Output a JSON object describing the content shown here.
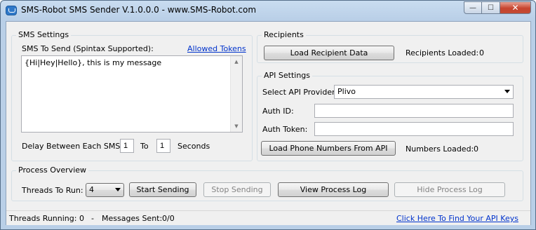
{
  "window": {
    "title": "SMS-Robot SMS Sender V.1.0.0.0 - www.SMS-Robot.com",
    "close_glyph": "✕",
    "min_glyph": "—",
    "max_glyph": "☐"
  },
  "sms_settings": {
    "group_label": "SMS Settings",
    "message_label": "SMS To Send (Spintax Supported):",
    "allowed_tokens_link": "Allowed Tokens",
    "message_text": "{Hi|Hey|Hello}, this is my message",
    "delay_label": "Delay Between Each SMS:",
    "delay_from": "1",
    "to_label": "To",
    "delay_to": "1",
    "seconds_label": "Seconds"
  },
  "recipients": {
    "group_label": "Recipients",
    "load_button": "Load Recipient Data",
    "loaded_label": "Recipients Loaded:",
    "loaded_count": "0"
  },
  "api_settings": {
    "group_label": "API Settings",
    "provider_label": "Select API Provider:",
    "provider_value": "Plivo",
    "auth_id_label": "Auth ID:",
    "auth_id_value": "",
    "auth_token_label": "Auth Token:",
    "auth_token_value": "",
    "load_numbers_button": "Load Phone Numbers From API",
    "numbers_loaded_label": "Numbers Loaded:",
    "numbers_loaded_count": "0"
  },
  "process": {
    "group_label": "Process Overview",
    "threads_label": "Threads To Run:",
    "threads_value": "4",
    "start_button": "Start Sending",
    "stop_button": "Stop Sending",
    "view_log_button": "View Process Log",
    "hide_log_button": "Hide Process Log"
  },
  "status": {
    "threads_running_label": "Threads Running:",
    "threads_running_value": "0",
    "separator": "-",
    "messages_sent_label": "Messages Sent:",
    "messages_sent_value": "0/0",
    "api_keys_link": "Click Here To Find Your API Keys"
  }
}
